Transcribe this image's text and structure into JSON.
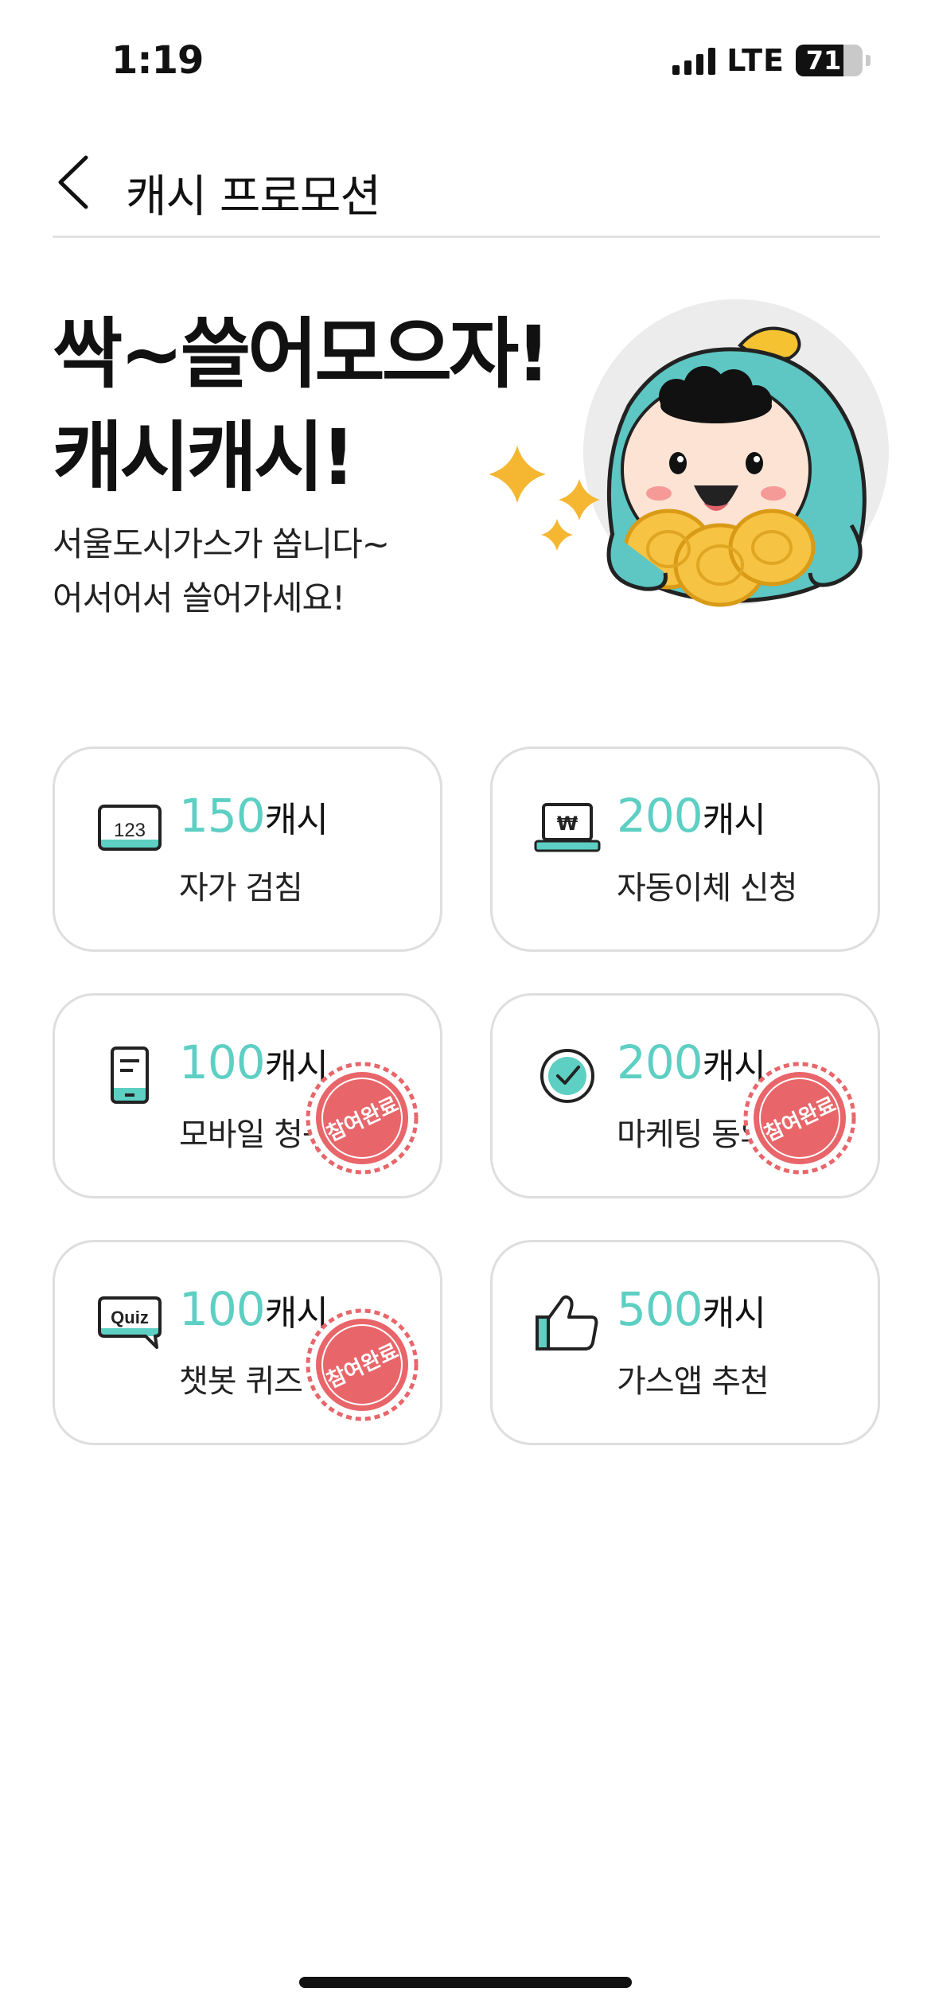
{
  "status_bar": {
    "time": "1:19",
    "network": "LTE",
    "battery": "71"
  },
  "nav": {
    "title": "캐시 프로모션"
  },
  "hero": {
    "title_line1": "싹~쓸어모으자!",
    "title_line2": "캐시캐시!",
    "subtitle_line1": "서울도시가스가 쏩니다~",
    "subtitle_line2": "어서어서 쓸어가세요!"
  },
  "cards": [
    {
      "icon": "meter-123-icon",
      "amount": "150",
      "unit": "캐시",
      "label": "자가 검침",
      "completed": false
    },
    {
      "icon": "laptop-won-icon",
      "amount": "200",
      "unit": "캐시",
      "label": "자동이체 신청",
      "completed": false
    },
    {
      "icon": "mobile-bill-icon",
      "amount": "100",
      "unit": "캐시",
      "label": "모바일 청구서",
      "completed": true
    },
    {
      "icon": "check-circle-icon",
      "amount": "200",
      "unit": "캐시",
      "label": "마케팅 동의",
      "completed": true
    },
    {
      "icon": "quiz-bubble-icon",
      "amount": "100",
      "unit": "캐시",
      "label": "챗봇 퀴즈",
      "completed": true
    },
    {
      "icon": "thumbs-up-icon",
      "amount": "500",
      "unit": "캐시",
      "label": "가스앱 추천",
      "completed": false
    }
  ],
  "stamp_text": "참여완료",
  "colors": {
    "accent": "#5dcfc3",
    "stamp": "#e8666a",
    "card_border": "#dedede"
  }
}
